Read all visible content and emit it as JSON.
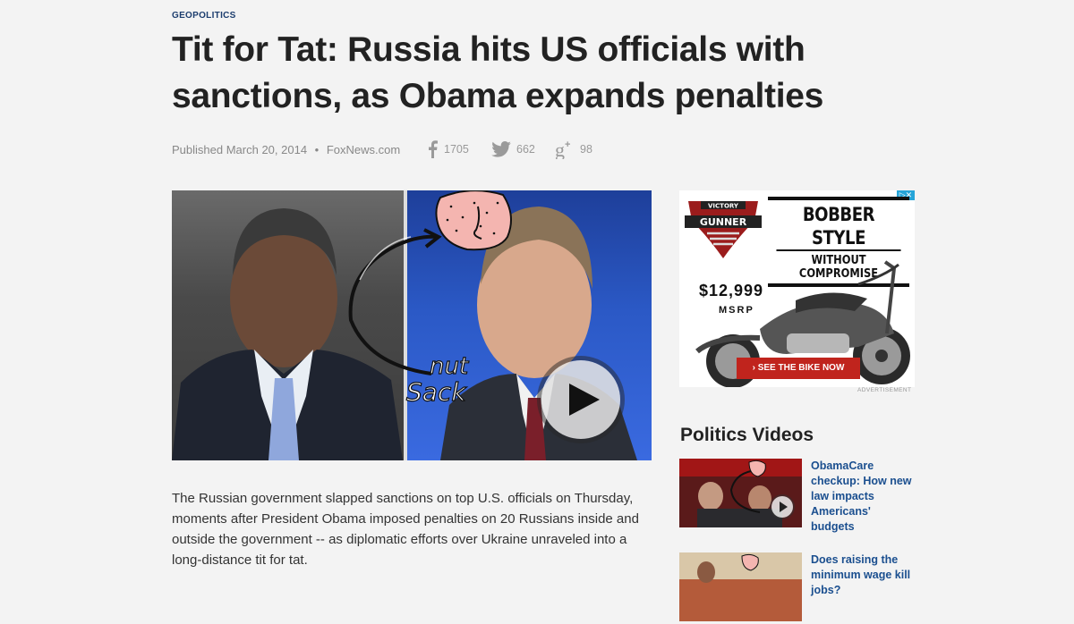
{
  "article": {
    "section": "GEOPOLITICS",
    "headline": "Tit for Tat: Russia hits US officials with sanctions, as Obama expands penalties",
    "published": "Published March 20, 2014",
    "separator": "•",
    "source": "FoxNews.com",
    "body": "The Russian government slapped sanctions on top U.S. officials on Thursday, moments after President Obama imposed penalties on 20 Russians inside and outside the government -- as diplomatic efforts over Ukraine unraveled into a long-distance tit for tat."
  },
  "share": {
    "facebook": {
      "icon": "facebook-icon",
      "count": "1705"
    },
    "twitter": {
      "icon": "twitter-icon",
      "count": "662"
    },
    "google_plus": {
      "icon": "google-plus-icon",
      "count": "98"
    }
  },
  "hero": {
    "annotation_line1": "nut",
    "annotation_line2": "Sack",
    "play_icon": "play-icon"
  },
  "ad": {
    "brand_top": "VICTORY",
    "brand_name": "GUNNER",
    "headline_line1": "BOBBER STYLE",
    "headline_line2": "WITHOUT COMPROMISE",
    "price": "$12,999",
    "msrp": "MSRP",
    "cta": "› SEE THE BIKE NOW",
    "label": "ADVERTISEMENT",
    "adchoices": "▷✕"
  },
  "sidebar": {
    "title": "Politics Videos",
    "videos": [
      {
        "caption": "ObamaCare checkup: How new law impacts Americans' budgets"
      },
      {
        "caption": "Does raising the minimum wage kill jobs?"
      }
    ]
  },
  "colors": {
    "section": "#1c3d6e",
    "link": "#1b4f8f",
    "ad_red": "#c0241d"
  }
}
